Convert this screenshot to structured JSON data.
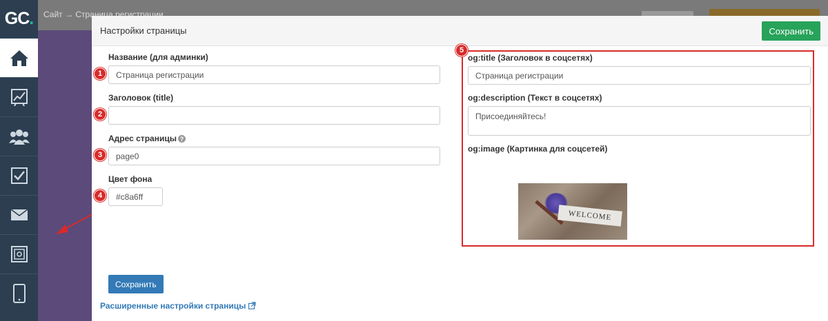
{
  "logo": {
    "main": "GC",
    "dot": "."
  },
  "topbar": {
    "breadcrumb": "Сайт → Страница регистрации"
  },
  "modal": {
    "title": "Настройки страницы",
    "save_top": "Сохранить",
    "save_bottom": "Сохранить",
    "advanced_link": "Расширенные настройки страницы"
  },
  "form": {
    "name": {
      "label": "Название (для админки)",
      "value": "Страница регистрации",
      "badge": "1"
    },
    "title": {
      "label": "Заголовок (title)",
      "value": "",
      "badge": "2"
    },
    "address": {
      "label": "Адрес страницы",
      "value": "page0",
      "badge": "3"
    },
    "bgcolor": {
      "label": "Цвет фона",
      "value": "#c8a6ff",
      "badge": "4"
    }
  },
  "og": {
    "badge": "5",
    "title": {
      "label": "og:title (Заголовок в соцсетях)",
      "value": "Страница регистрации"
    },
    "description": {
      "label": "og:description (Текст в соцсетях)",
      "value": "Присоединяйтесь!"
    },
    "image": {
      "label": "og:image (Картинка для соцсетей)",
      "tag_text": "WELCOME"
    }
  },
  "sidebar": {
    "items": [
      {
        "icon": "home-icon"
      },
      {
        "icon": "chart-icon"
      },
      {
        "icon": "users-icon"
      },
      {
        "icon": "checkbox-icon"
      },
      {
        "icon": "mail-icon"
      },
      {
        "icon": "safe-icon"
      },
      {
        "icon": "mobile-icon"
      }
    ]
  },
  "colors": {
    "accent_green": "#27a35a",
    "accent_blue": "#337ab7",
    "annotation_red": "#d92a2a",
    "sidebar": "#2c3e50"
  }
}
